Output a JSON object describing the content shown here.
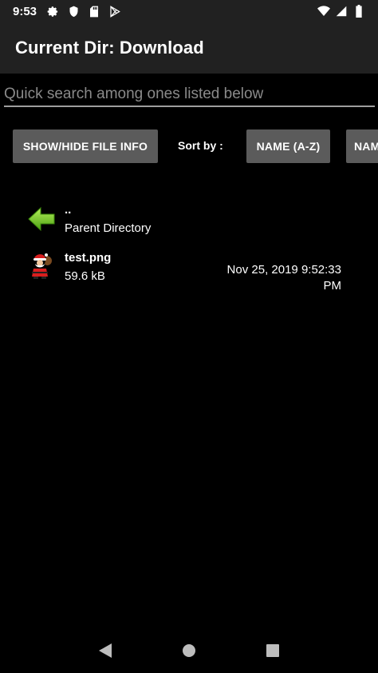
{
  "status_bar": {
    "time": "9:53",
    "left_icons": [
      "gear-icon",
      "shield-icon",
      "sd-card-icon",
      "play-store-icon"
    ],
    "right_icons": [
      "wifi-icon",
      "signal-icon",
      "battery-icon"
    ]
  },
  "app_bar": {
    "title": "Current Dir: Download"
  },
  "search": {
    "placeholder": "Quick search among ones listed below",
    "value": ""
  },
  "controls": {
    "show_hide_label": "SHOW/HIDE FILE INFO",
    "sort_label": "Sort by :",
    "sort_name_az": "NAME (A-Z)",
    "sort_name_2": "NAM"
  },
  "files": [
    {
      "name": "..",
      "sub": "Parent Directory",
      "icon": "back-arrow-icon"
    },
    {
      "name": "test.png",
      "sub": "59.6 kB",
      "date": "Nov 25, 2019 9:52:33 PM",
      "icon": "santa-image-icon"
    }
  ],
  "nav": {
    "icons": [
      "back-icon",
      "home-icon",
      "recents-icon"
    ]
  },
  "colors": {
    "background": "#000000",
    "bar": "#212121",
    "button": "#5b5b5b",
    "arrow_green": "#7ed321"
  }
}
